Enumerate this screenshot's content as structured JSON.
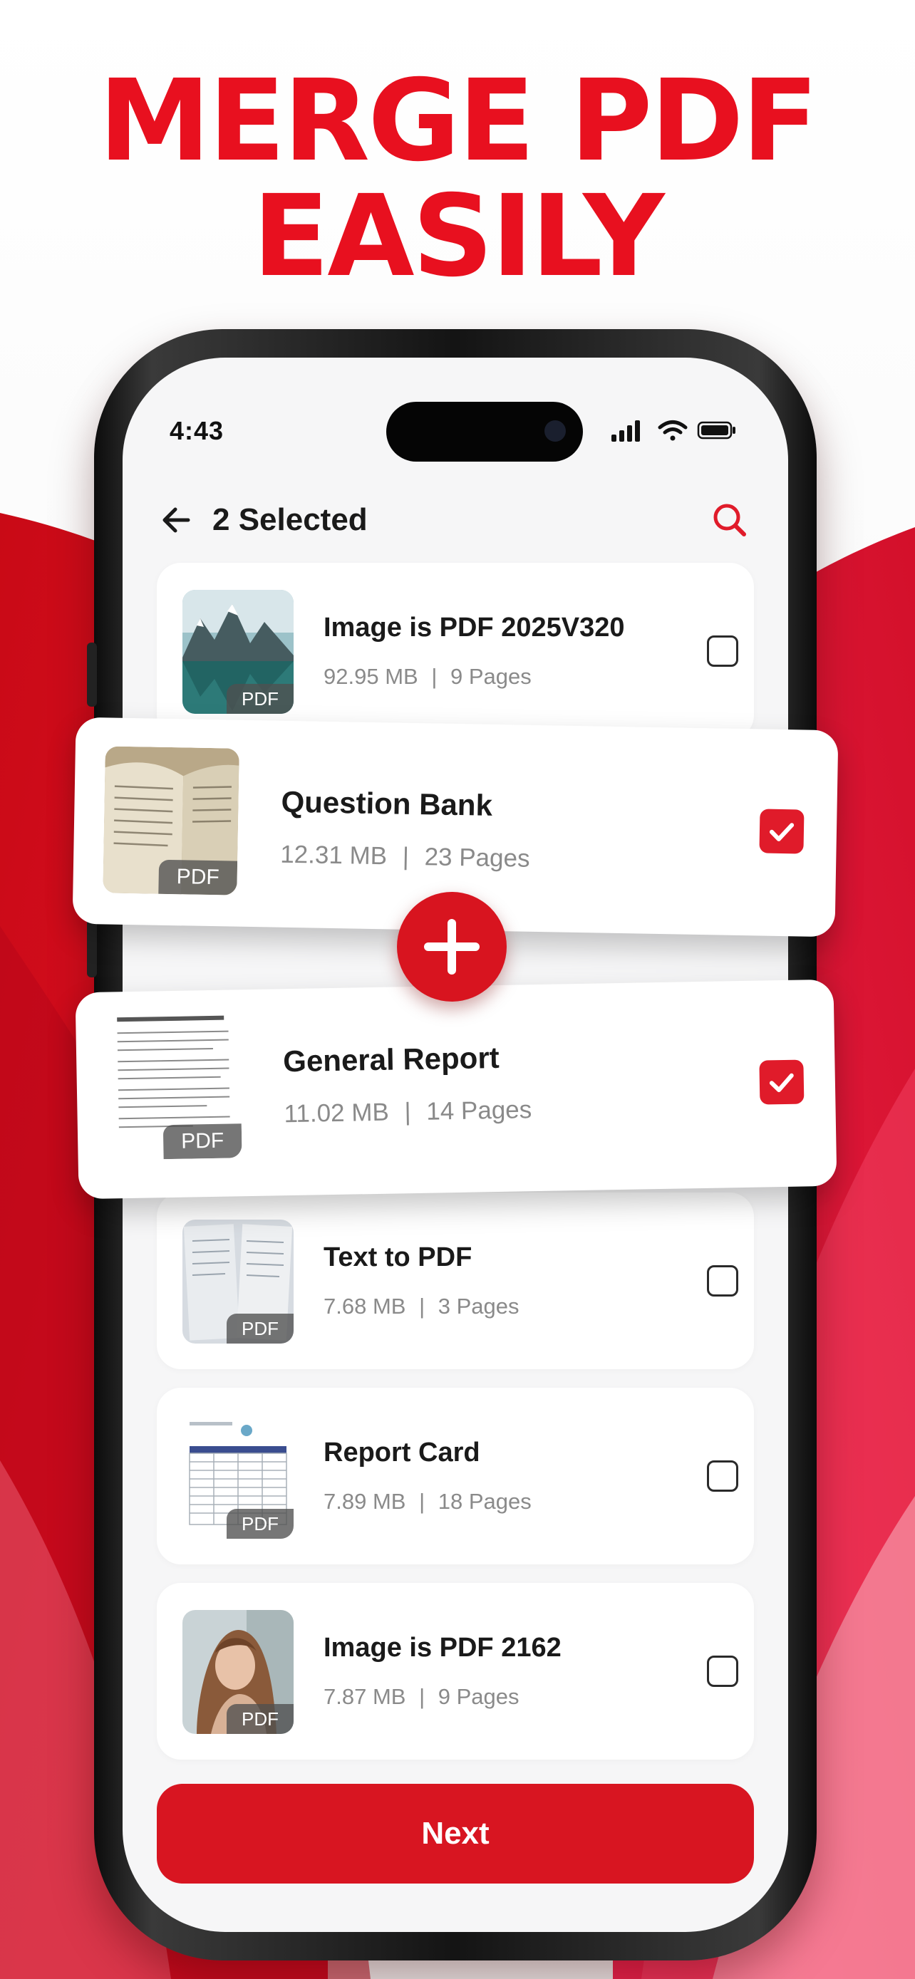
{
  "banner": {
    "line1": "MERGE PDF",
    "line2": "EASILY"
  },
  "colors": {
    "accent": "#e01b2a",
    "headline": "#e8101f",
    "background_red": "#d8141f"
  },
  "status_bar": {
    "time": "4:43",
    "icons": [
      "signal-icon",
      "wifi-icon",
      "battery-icon"
    ]
  },
  "header": {
    "back_icon": "arrow-left-icon",
    "title": "2 Selected",
    "search_icon": "search-icon"
  },
  "files": [
    {
      "name": "Image is PDF 2025V320",
      "size": "92.95 MB",
      "pages": "9 Pages",
      "tag": "PDF",
      "checked": false,
      "thumb": "mountain-lake"
    },
    {
      "name": "Question Bank",
      "size": "12.31 MB",
      "pages": "23 Pages",
      "tag": "PDF",
      "checked": true,
      "thumb": "open-book"
    },
    {
      "name": "General Report",
      "size": "11.02 MB",
      "pages": "14 Pages",
      "tag": "PDF",
      "checked": true,
      "thumb": "text-document"
    },
    {
      "name": "Text to PDF",
      "size": "7.68 MB",
      "pages": "3 Pages",
      "tag": "PDF",
      "checked": false,
      "thumb": "notebook-pages"
    },
    {
      "name": "Report Card",
      "size": "7.89 MB",
      "pages": "18 Pages",
      "tag": "PDF",
      "checked": false,
      "thumb": "table-document"
    },
    {
      "name": "Image is PDF 2162",
      "size": "7.87 MB",
      "pages": "9 Pages",
      "tag": "PDF",
      "checked": false,
      "thumb": "portrait-photo"
    }
  ],
  "merge_icon": "plus-icon",
  "next_button": {
    "label": "Next"
  },
  "separator": "|"
}
